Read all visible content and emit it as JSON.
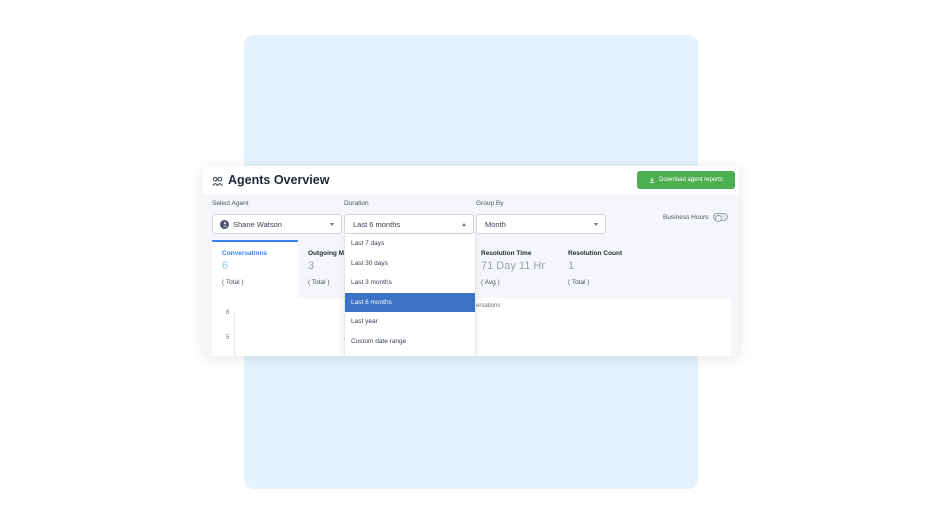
{
  "header": {
    "title": "Agents Overview",
    "download_label": "Download agent reports",
    "icon": "agents-icon"
  },
  "filters": {
    "agent": {
      "label": "Select Agent",
      "value": "Shane Watson"
    },
    "duration": {
      "label": "Duration",
      "value": "Last 6 months"
    },
    "group_by": {
      "label": "Group By",
      "value": "Month"
    },
    "business_hours_label": "Business Hours",
    "business_hours_on": false
  },
  "duration_options": [
    "Last 7 days",
    "Last 30 days",
    "Last 3 months",
    "Last 6 months",
    "Last year",
    "Custom date range"
  ],
  "metrics": [
    {
      "title": "Conversations",
      "value": "6",
      "sub": "( Total )"
    },
    {
      "title": "Outgoing M",
      "value": "3",
      "sub": "( Total )"
    },
    {
      "title": "Resolution Time",
      "value": "71 Day 11 Hr",
      "sub": "( Avg )"
    },
    {
      "title": "Resolution Count",
      "value": "1",
      "sub": "( Total )"
    }
  ],
  "chart": {
    "caption": "versations",
    "tick_labels": [
      "6",
      "5"
    ]
  },
  "colors": {
    "accent": "#3b82f6",
    "download_button": "#4caf50",
    "selected_option": "#3a72c6",
    "backdrop": "#e3f2fc"
  }
}
